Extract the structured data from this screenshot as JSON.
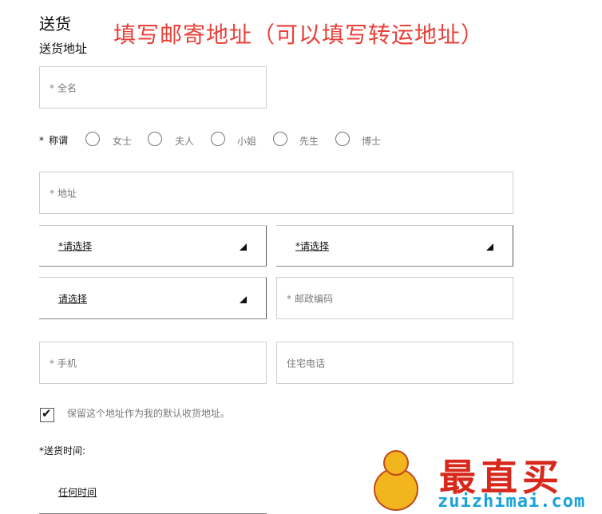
{
  "section": {
    "title": "送货",
    "subtitle": "送货地址",
    "annotation": "填写邮寄地址（可以填写转运地址）"
  },
  "form": {
    "required_marker": "*",
    "full_name_placeholder": "全名",
    "salutation": {
      "label": "称谓",
      "options": [
        "女士",
        "夫人",
        "小姐",
        "先生",
        "博士"
      ]
    },
    "address_placeholder": "地址",
    "select_country": "*请选择",
    "select_region": "*请选择",
    "select_city": "请选择",
    "postal_code_placeholder": "邮政编码",
    "mobile_placeholder": "手机",
    "home_phone_placeholder": "住宅电话",
    "save_address_label": "保留这个地址作为我的默认收货地址。",
    "save_address_checked": true,
    "delivery_time_label": "*送货时间:",
    "delivery_time_value": "任何时间"
  },
  "watermark": {
    "brand": "最直买",
    "url": "zuizhimai.com"
  }
}
